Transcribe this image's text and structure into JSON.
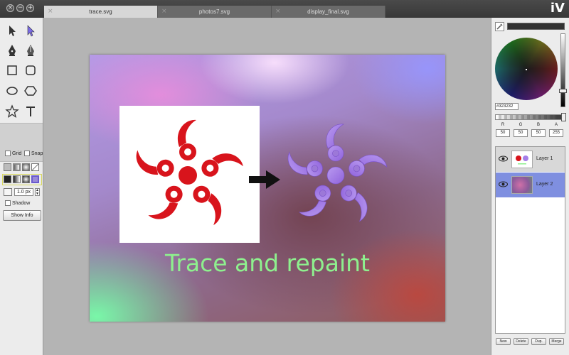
{
  "window": {
    "tabs": [
      {
        "label": "trace.svg",
        "active": true
      },
      {
        "label": "photos7.svg",
        "active": false
      },
      {
        "label": "display_final.svg",
        "active": false
      }
    ],
    "app_logo": "iV",
    "controls": [
      "close",
      "minimize",
      "zoom"
    ]
  },
  "toolbar": {
    "tools": [
      "pointer",
      "direct-select",
      "pen",
      "pen-alt",
      "rectangle",
      "rounded-rectangle",
      "ellipse",
      "hexagon",
      "star",
      "text"
    ],
    "grid_label": "Grid",
    "snap_label": "Snap",
    "stroke_width": "1.0 px",
    "shadow_label": "Shadow",
    "show_info_label": "Show Info"
  },
  "canvas": {
    "caption": "Trace and repaint",
    "caption_color": "#8ef08e",
    "original_logo_color": "#d8141c",
    "traced_logo_color": "#a57ee8"
  },
  "color_panel": {
    "hex": "#323232",
    "labels": [
      "R",
      "G",
      "B",
      "A"
    ],
    "values": [
      "50",
      "50",
      "50",
      "255"
    ],
    "current_color": "#323232"
  },
  "layers": {
    "items": [
      {
        "name": "Layer 1",
        "selected": false
      },
      {
        "name": "Layer 2",
        "selected": true
      }
    ],
    "buttons": [
      "New",
      "Delete",
      "Dup.",
      "Merge"
    ]
  }
}
